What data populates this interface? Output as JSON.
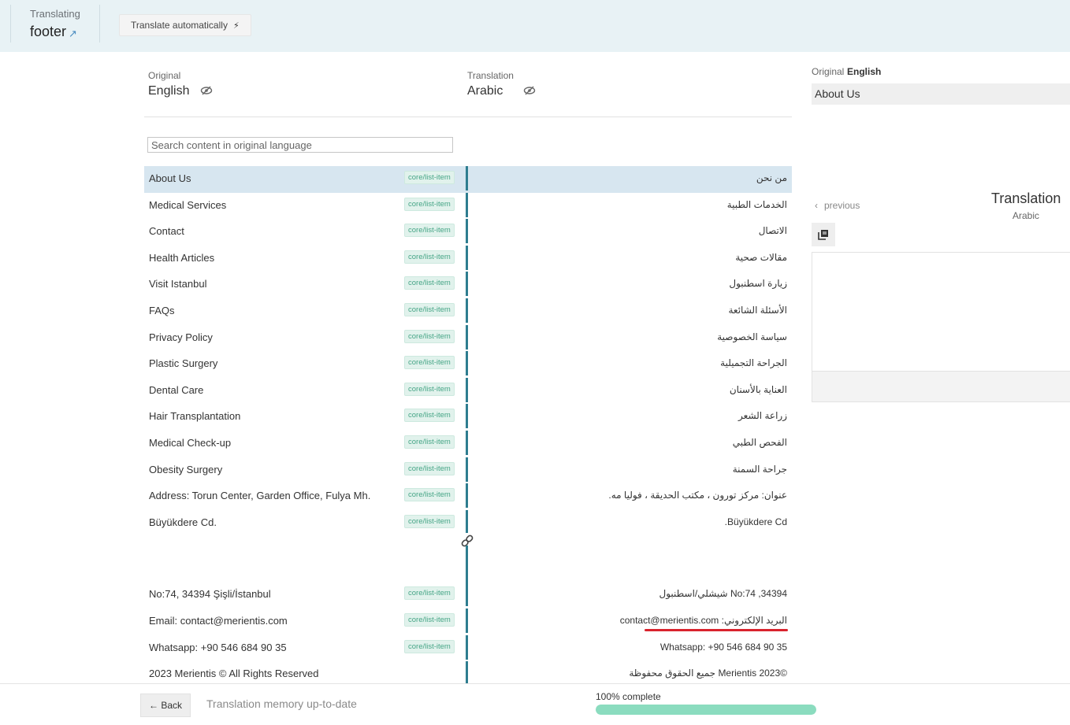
{
  "header": {
    "translating_label": "Translating",
    "doc_name": "footer",
    "auto_translate_label": "Translate automatically"
  },
  "languages": {
    "original_label": "Original",
    "original_lang": "English",
    "translation_label": "Translation",
    "translation_lang": "Arabic"
  },
  "search": {
    "placeholder": "Search content in original language"
  },
  "rows": [
    {
      "original": "About Us",
      "tag": "core/list-item",
      "translation": "من نحن",
      "selected": true
    },
    {
      "original": "Medical Services",
      "tag": "core/list-item",
      "translation": "الخدمات الطبية"
    },
    {
      "original": "Contact",
      "tag": "core/list-item",
      "translation": "الاتصال"
    },
    {
      "original": "Health Articles",
      "tag": "core/list-item",
      "translation": "مقالات صحية"
    },
    {
      "original": "Visit Istanbul",
      "tag": "core/list-item",
      "translation": "زيارة اسطنبول"
    },
    {
      "original": "FAQs",
      "tag": "core/list-item",
      "translation": "الأسئلة الشائعة"
    },
    {
      "original": "Privacy Policy",
      "tag": "core/list-item",
      "translation": "سياسة الخصوصية"
    },
    {
      "original": "Plastic Surgery",
      "tag": "core/list-item",
      "translation": "الجراحة التجميلية"
    },
    {
      "original": "Dental Care",
      "tag": "core/list-item",
      "translation": "العناية بالأسنان"
    },
    {
      "original": "Hair Transplantation",
      "tag": "core/list-item",
      "translation": "زراعة الشعر"
    },
    {
      "original": "Medical Check-up",
      "tag": "core/list-item",
      "translation": "الفحص الطبي"
    },
    {
      "original": "Obesity Surgery",
      "tag": "core/list-item",
      "translation": "جراحة السمنة"
    },
    {
      "original": "Address: Torun Center, Garden Office, Fulya Mh.",
      "tag": "core/list-item",
      "translation": "عنوان: مركز تورون ، مكتب الحديقة ، فوليا مه."
    },
    {
      "original": "Büyükdere Cd.",
      "tag": "core/list-item",
      "translation": "Büyükdere Cd."
    },
    {
      "spacer": true
    },
    {
      "original": "No:74, 34394 Şişli/İstanbul",
      "tag": "core/list-item",
      "translation": "No:74 ,34394 شيشلي/اسطنبول"
    },
    {
      "original": "Email: contact@merientis.com",
      "tag": "core/list-item",
      "translation": "البريد الإلكتروني: contact@merientis.com"
    },
    {
      "original": "Whatsapp: +90 546 684 90 35",
      "tag": "core/list-item",
      "translation": "Whatsapp: +90 546 684 90 35",
      "ltr": true
    },
    {
      "original": "2023 Merientis © All Rights Reserved",
      "tag": "",
      "translation": "©Merientis 2023 جميع الحقوق محفوظة"
    }
  ],
  "side_panel": {
    "original_label": "Original",
    "original_lang": "English",
    "original_text": "About Us",
    "previous_label": "previous",
    "translation_title": "Translation",
    "translation_lang": "Arabic"
  },
  "footer": {
    "back_label": "← Back",
    "tm_status": "Translation memory up-to-date",
    "progress_label": "100% complete",
    "progress_fraction": 1.0
  },
  "colors": {
    "accent_bar": "#2e7d8f",
    "highlight_underline": "#d9232d",
    "progress": "#8bdcbf"
  }
}
